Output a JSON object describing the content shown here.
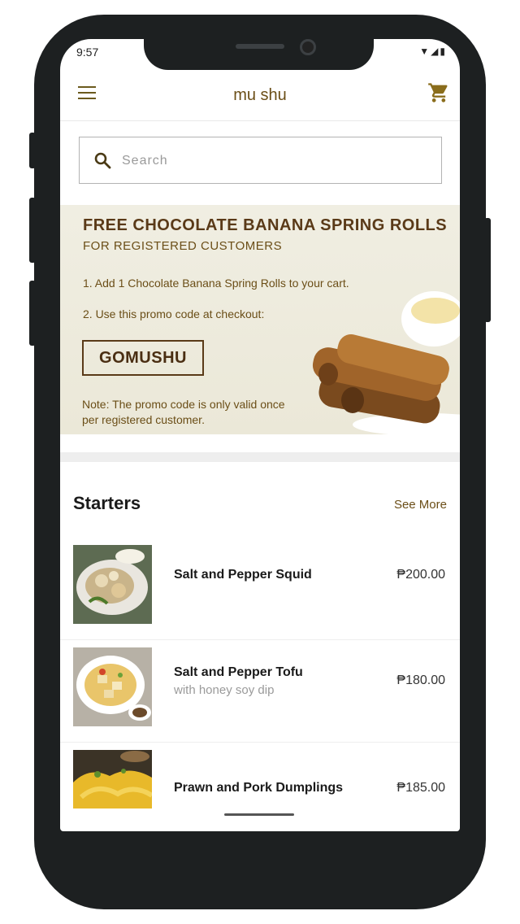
{
  "status_bar": {
    "time": "9:57",
    "icons": "▼◢▮"
  },
  "app_bar": {
    "title": "mu shu",
    "menu_icon": "menu-icon",
    "cart_icon": "cart-icon"
  },
  "search": {
    "placeholder": "Search",
    "value": ""
  },
  "promo": {
    "title": "FREE CHOCOLATE BANANA SPRING ROLLS",
    "subtitle": "FOR REGISTERED CUSTOMERS",
    "step1": "1. Add 1 Chocolate Banana Spring Rolls to your cart.",
    "step2": "2. Use this promo code at checkout:",
    "code": "GOMUSHU",
    "note": "Note: The promo code is only valid once per registered customer."
  },
  "section": {
    "title": "Starters",
    "see_more": "See More"
  },
  "items": [
    {
      "name": "Salt and Pepper Squid",
      "desc": "",
      "price": "₱200.00"
    },
    {
      "name": "Salt and Pepper Tofu",
      "desc": "with honey soy dip",
      "price": "₱180.00"
    },
    {
      "name": "Prawn and Pork Dumplings",
      "desc": "",
      "price": "₱185.00"
    }
  ],
  "colors": {
    "accent": "#6b4e17",
    "promo_bg": "#ece9da",
    "frame": "#1d2021"
  }
}
